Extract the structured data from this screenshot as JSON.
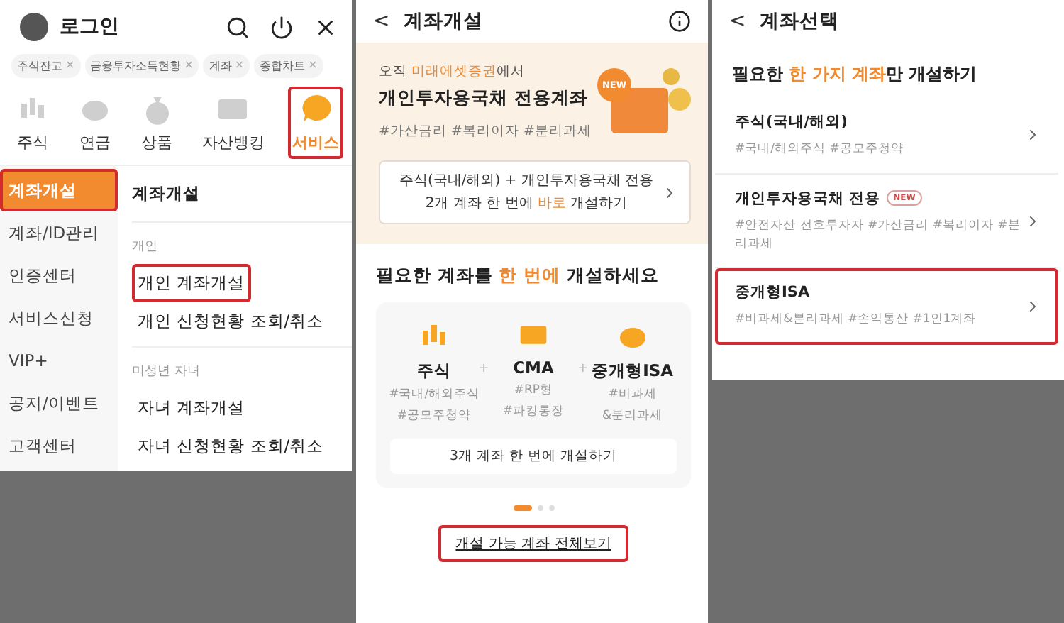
{
  "menu_screen": {
    "title": "로그인",
    "recent_tags": [
      {
        "label": "주식잔고"
      },
      {
        "label": "금융투자소득현황"
      },
      {
        "label": "계좌"
      },
      {
        "label": "종합차트"
      }
    ],
    "tag_remove": "×",
    "categories": [
      {
        "kind": "candles",
        "label": "주식",
        "selected": false,
        "highlighted": false
      },
      {
        "kind": "piggy",
        "label": "연금",
        "selected": false,
        "highlighted": false
      },
      {
        "kind": "bag",
        "label": "상품",
        "selected": false,
        "highlighted": false
      },
      {
        "kind": "bank",
        "label": "자산뱅킹",
        "selected": false,
        "highlighted": false
      },
      {
        "kind": "chat",
        "label": "서비스",
        "selected": true,
        "highlighted": true
      }
    ],
    "sidebar": [
      {
        "label": "계좌개설",
        "selected": true,
        "highlighted": true
      },
      {
        "label": "계좌/ID관리",
        "selected": false,
        "highlighted": false
      },
      {
        "label": "인증센터",
        "selected": false,
        "highlighted": false
      },
      {
        "label": "서비스신청",
        "selected": false,
        "highlighted": false
      },
      {
        "label": "VIP+",
        "selected": false,
        "highlighted": false
      },
      {
        "label": "공지/이벤트",
        "selected": false,
        "highlighted": false
      },
      {
        "label": "고객센터",
        "selected": false,
        "highlighted": false
      }
    ],
    "menu_title": "계좌개설",
    "sections": [
      {
        "heading": "개인",
        "items": [
          {
            "label": "개인 계좌개설",
            "highlighted": true
          },
          {
            "label": "개인 신청현황 조회/취소",
            "highlighted": false
          }
        ]
      },
      {
        "heading": "미성년 자녀",
        "items": [
          {
            "label": "자녀 계좌개설",
            "highlighted": false
          },
          {
            "label": "자녀 신청현황 조회/취소",
            "highlighted": false
          }
        ]
      }
    ]
  },
  "open_screen": {
    "back": "<",
    "title": "계좌개설",
    "banner": {
      "intro": [
        {
          "text": "오직 ",
          "accent": false
        },
        {
          "text": "미래에셋증권",
          "accent": true
        },
        {
          "text": "에서",
          "accent": false
        }
      ],
      "title": "개인투자용국채 전용계좌",
      "tags": "#가산금리 #복리이자 #분리과세",
      "badge": "NEW",
      "cta_line1": "주식(국내/해외) + 개인투자용국채 전용",
      "cta_line2": [
        {
          "text": "2개 계좌 한 번에 ",
          "accent": false
        },
        {
          "text": "바로",
          "accent": true
        },
        {
          "text": " 개설하기",
          "accent": false
        }
      ]
    },
    "heading": [
      {
        "text": "필요한 계좌를 ",
        "accent": false
      },
      {
        "text": "한 번에",
        "accent": true
      },
      {
        "text": " 개설하세요",
        "accent": false
      }
    ],
    "bundle": [
      {
        "kind": "candles",
        "name": "주식",
        "tags": [
          "#국내/해외주식",
          "#공모주청약"
        ]
      },
      {
        "kind": "card",
        "name": "CMA",
        "tags": [
          "#RP형",
          "#파킹통장"
        ]
      },
      {
        "kind": "piggy",
        "name": "중개형ISA",
        "tags": [
          "#비과세",
          "&분리과세"
        ]
      }
    ],
    "joiner": "+",
    "bundle_button": "3개 계좌 한 번에 개설하기",
    "dots": [
      {
        "selected": true
      },
      {
        "selected": false
      },
      {
        "selected": false
      }
    ],
    "all_link": {
      "label": "개설 가능 계좌 전체보기",
      "highlighted": true
    }
  },
  "select_screen": {
    "back": "<",
    "title": "계좌선택",
    "heading": [
      {
        "text": "필요한 ",
        "accent": false
      },
      {
        "text": "한 가지 계좌",
        "accent": true
      },
      {
        "text": "만 개설하기",
        "accent": false
      }
    ],
    "accounts": [
      {
        "name": "주식(국내/해외)",
        "tags": "#국내/해외주식 #공모주청약",
        "highlighted": false
      },
      {
        "name": "개인투자용국채 전용",
        "badge": "NEW",
        "tags": "#안전자산 선호투자자 #가산금리 #복리이자 #분리과세",
        "highlighted": false
      },
      {
        "name": "중개형ISA",
        "tags": "#비과세&분리과세 #손익통산 #1인1계좌",
        "highlighted": true
      }
    ]
  }
}
